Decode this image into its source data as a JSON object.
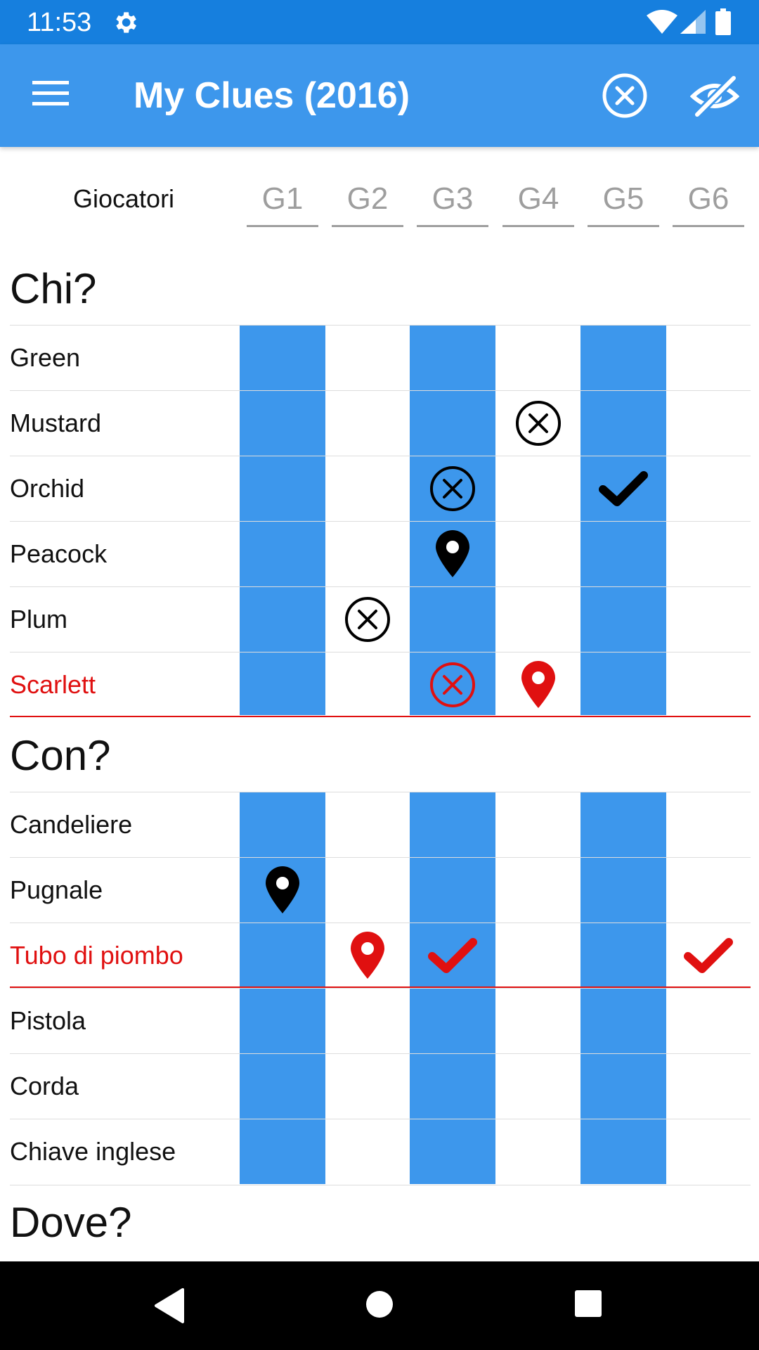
{
  "status_bar": {
    "time": "11:53"
  },
  "app_bar": {
    "title": "My Clues (2016)"
  },
  "players": {
    "label": "Giocatori",
    "names": [
      "G1",
      "G2",
      "G3",
      "G4",
      "G5",
      "G6"
    ]
  },
  "sections": [
    {
      "title": "Chi?"
    },
    {
      "title": "Con?"
    },
    {
      "title": "Dove?"
    }
  ],
  "rows": [
    {
      "label": "Green",
      "highlight": false
    },
    {
      "label": "Mustard",
      "highlight": false
    },
    {
      "label": "Orchid",
      "highlight": false
    },
    {
      "label": "Peacock",
      "highlight": false
    },
    {
      "label": "Plum",
      "highlight": false
    },
    {
      "label": "Scarlett",
      "highlight": true
    },
    {
      "label": "Candeliere",
      "highlight": false
    },
    {
      "label": "Pugnale",
      "highlight": false
    },
    {
      "label": "Tubo di piombo",
      "highlight": true
    },
    {
      "label": "Pistola",
      "highlight": false
    },
    {
      "label": "Corda",
      "highlight": false
    },
    {
      "label": "Chiave inglese",
      "highlight": false
    }
  ],
  "marks": [
    {
      "row": "Mustard",
      "player": "G4",
      "icon": "cross-circle-icon",
      "color": "#000000"
    },
    {
      "row": "Orchid",
      "player": "G3",
      "icon": "cross-circle-icon",
      "color": "#000000"
    },
    {
      "row": "Orchid",
      "player": "G5",
      "icon": "check-icon",
      "color": "#000000"
    },
    {
      "row": "Peacock",
      "player": "G3",
      "icon": "location-pin-icon",
      "color": "#000000"
    },
    {
      "row": "Plum",
      "player": "G2",
      "icon": "cross-circle-icon",
      "color": "#000000"
    },
    {
      "row": "Scarlett",
      "player": "G3",
      "icon": "cross-circle-icon",
      "color": "#e01010"
    },
    {
      "row": "Scarlett",
      "player": "G4",
      "icon": "location-pin-icon",
      "color": "#e01010"
    },
    {
      "row": "Pugnale",
      "player": "G1",
      "icon": "location-pin-icon",
      "color": "#000000"
    },
    {
      "row": "Tubo di piombo",
      "player": "G2",
      "icon": "location-pin-icon",
      "color": "#e01010"
    },
    {
      "row": "Tubo di piombo",
      "player": "G3",
      "icon": "check-icon",
      "color": "#e01010"
    },
    {
      "row": "Tubo di piombo",
      "player": "G6",
      "icon": "check-icon",
      "color": "#e01010"
    }
  ],
  "colors": {
    "primary": "#3d97ec",
    "status_bar": "#167fde",
    "highlight": "#e01010"
  }
}
